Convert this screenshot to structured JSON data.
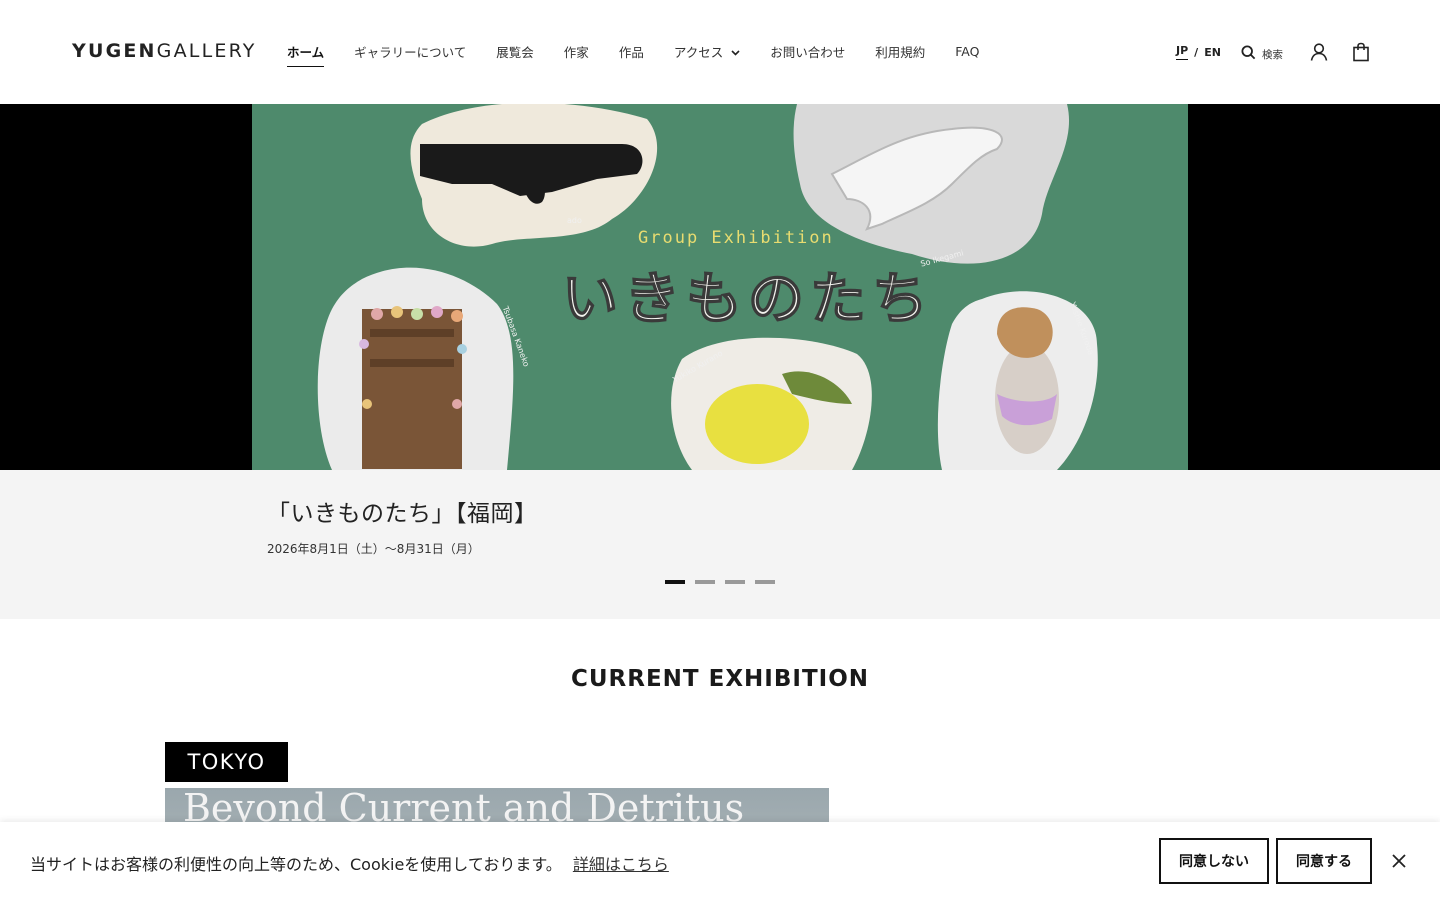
{
  "header": {
    "logo_bold": "YUGEN",
    "logo_light": "GALLERY",
    "nav": [
      {
        "label": "ホーム",
        "active": true
      },
      {
        "label": "ギャラリーについて"
      },
      {
        "label": "展覧会"
      },
      {
        "label": "作家"
      },
      {
        "label": "作品"
      },
      {
        "label": "アクセス",
        "dropdown": true
      },
      {
        "label": "お問い合わせ"
      },
      {
        "label": "利用規約"
      },
      {
        "label": "FAQ"
      }
    ],
    "lang_jp": "JP",
    "lang_sep": "/",
    "lang_en": "EN",
    "search_label": "検索"
  },
  "hero": {
    "exhibition_en": "Group Exhibition",
    "exhibition_jp": "いきものたち",
    "artist_labels": [
      "ado",
      "So Ikegami",
      "Tsubasa Kaneko",
      "Yukiko Kurano",
      "Yoshie Kuroda"
    ],
    "caption_title": "「いきものたち」【福岡】",
    "caption_date": "2026年8月1日（土）〜8月31日（月）",
    "slide_count": 4,
    "active_slide": 0
  },
  "current": {
    "section_title": "CURRENT EXHIBITION",
    "location_tag": "TOKYO",
    "card_title": "Beyond Current and Detritus"
  },
  "cookie": {
    "message": "当サイトはお客様の利便性の向上等のため、Cookieを使用しております。",
    "link": "詳細はこちら",
    "decline": "同意しない",
    "accept": "同意する"
  },
  "colors": {
    "hero_green": "#4e8a6c",
    "caption_bg": "#f4f4f4",
    "text": "#222222"
  }
}
